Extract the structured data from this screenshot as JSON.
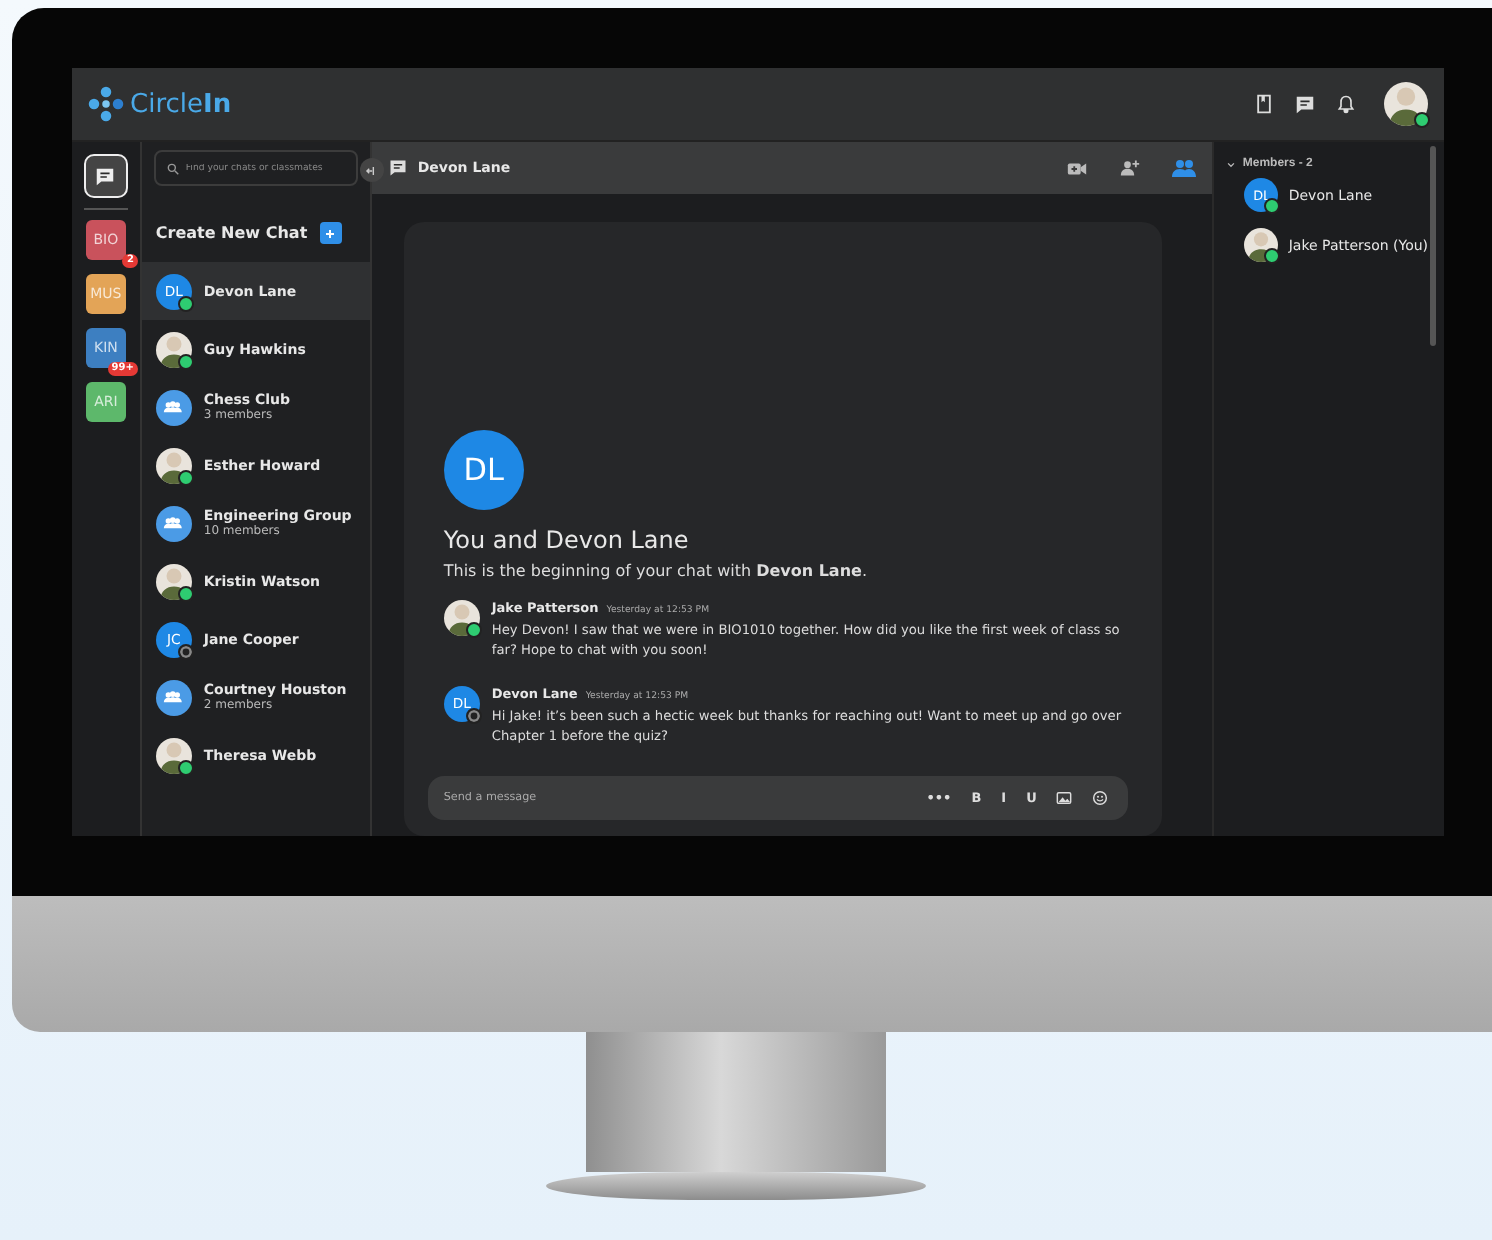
{
  "header": {
    "logo": "Circle**In**",
    "avatar_online": true
  },
  "rail": {
    "chat_selected": true,
    "courses": [
      {
        "code": "BIO",
        "color": "#c9525c",
        "badge": "2"
      },
      {
        "code": "MUS",
        "color": "#e3a457"
      },
      {
        "code": "KIN",
        "color": "#3d7fc1",
        "badge": "99+"
      },
      {
        "code": "ARI",
        "color": "#5db86b"
      }
    ]
  },
  "chat_list": {
    "search": {
      "placeholder": "Find your chats or classmates"
    },
    "create_label": "Create New Chat",
    "chats": [
      {
        "name": "Devon Lane",
        "kind": "initials",
        "initials": "DL",
        "online": true,
        "selected": true
      },
      {
        "name": "Guy Hawkins",
        "kind": "photo",
        "online": true,
        "selected": false
      },
      {
        "name": "Chess Club",
        "subtitle": "3 members",
        "kind": "group",
        "selected": false
      },
      {
        "name": "Esther Howard",
        "kind": "photo",
        "online": true,
        "selected": false
      },
      {
        "name": "Engineering Group",
        "subtitle": "10 members",
        "kind": "group",
        "selected": false
      },
      {
        "name": "Kristin Watson",
        "kind": "photo",
        "online": true,
        "selected": false
      },
      {
        "name": "Jane Cooper",
        "kind": "initials",
        "initials": "JC",
        "online": false,
        "selected": false
      },
      {
        "name": "Courtney Houston",
        "subtitle": "2 members",
        "kind": "group",
        "selected": false
      },
      {
        "name": "Theresa Webb",
        "kind": "photo",
        "online": true,
        "selected": false
      }
    ]
  },
  "conversation": {
    "title": "Devon Lane",
    "members_panel_open": true,
    "intro": {
      "initials": "DL",
      "title": "You and Devon Lane",
      "text": "This is the beginning of your chat with **Devon Lane**."
    },
    "messages": [
      {
        "author": "Jake Patterson",
        "time": "Yesterday at 12:53 PM",
        "kind": "photo",
        "online": true,
        "text": "Hey Devon! I saw that we were in BIO1010 together. How did you like the first week of class so far? Hope to chat with you soon!"
      },
      {
        "author": "Devon Lane",
        "time": "Yesterday at 12:53 PM",
        "kind": "initials",
        "initials": "DL",
        "online": false,
        "text": "Hi Jake! it’s been such a hectic week but thanks for reaching out! Want to meet up and go over Chapter 1 before the quiz?"
      }
    ],
    "composer": {
      "placeholder": "Send a message",
      "tools": [
        {
          "kind": "text",
          "label": "•••"
        },
        {
          "kind": "text",
          "label": "B"
        },
        {
          "kind": "text",
          "label": "I"
        },
        {
          "kind": "text",
          "label": "U"
        },
        {
          "kind": "image"
        },
        {
          "kind": "emoji"
        }
      ]
    }
  },
  "members": {
    "heading": "Members - 2",
    "expanded": true,
    "list": [
      {
        "name": "Devon Lane",
        "kind": "initials",
        "initials": "DL",
        "online": true
      },
      {
        "name": "Jake Patterson (You)",
        "kind": "photo",
        "online": true
      }
    ]
  }
}
